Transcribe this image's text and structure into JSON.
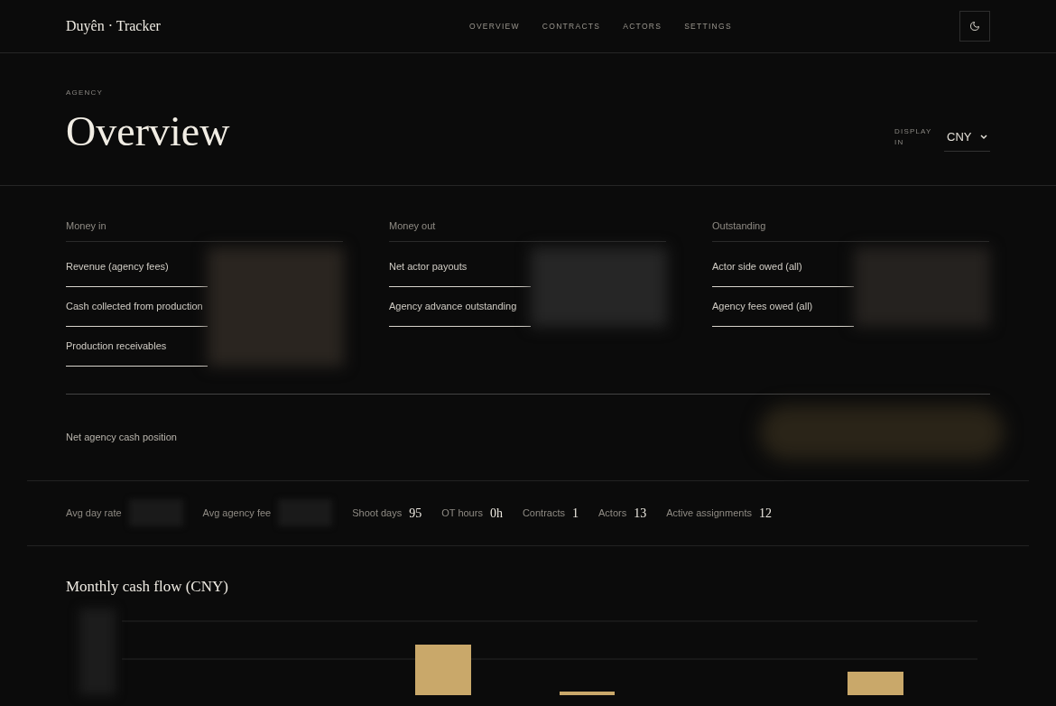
{
  "brand": "Duyên · Tracker",
  "nav": [
    "OVERVIEW",
    "CONTRACTS",
    "ACTORS",
    "SETTINGS"
  ],
  "eyebrow": "AGENCY",
  "title": "Overview",
  "display": {
    "label": "DISPLAY IN",
    "value": "CNY"
  },
  "groups": [
    {
      "title": "Money in",
      "rows": [
        "Revenue (agency fees)",
        "Cash collected from production",
        "Production receivables"
      ]
    },
    {
      "title": "Money out",
      "rows": [
        "Net actor payouts",
        "Agency advance outstanding"
      ]
    },
    {
      "title": "Outstanding",
      "rows": [
        "Actor side owed (all)",
        "Agency fees owed (all)"
      ]
    }
  ],
  "net": {
    "label": "Net agency cash position"
  },
  "stats": [
    {
      "label": "Avg day rate",
      "kind": "hidden"
    },
    {
      "label": "Avg agency fee",
      "kind": "hidden"
    },
    {
      "label": "Shoot days",
      "kind": "number",
      "value": "95"
    },
    {
      "label": "OT hours",
      "kind": "number",
      "value": "0h"
    },
    {
      "label": "Contracts",
      "kind": "number",
      "value": "1"
    },
    {
      "label": "Actors",
      "kind": "number",
      "value": "13"
    },
    {
      "label": "Active assignments",
      "kind": "number",
      "value": "12"
    }
  ],
  "chart": {
    "title": "Monthly cash flow (CNY)"
  }
}
